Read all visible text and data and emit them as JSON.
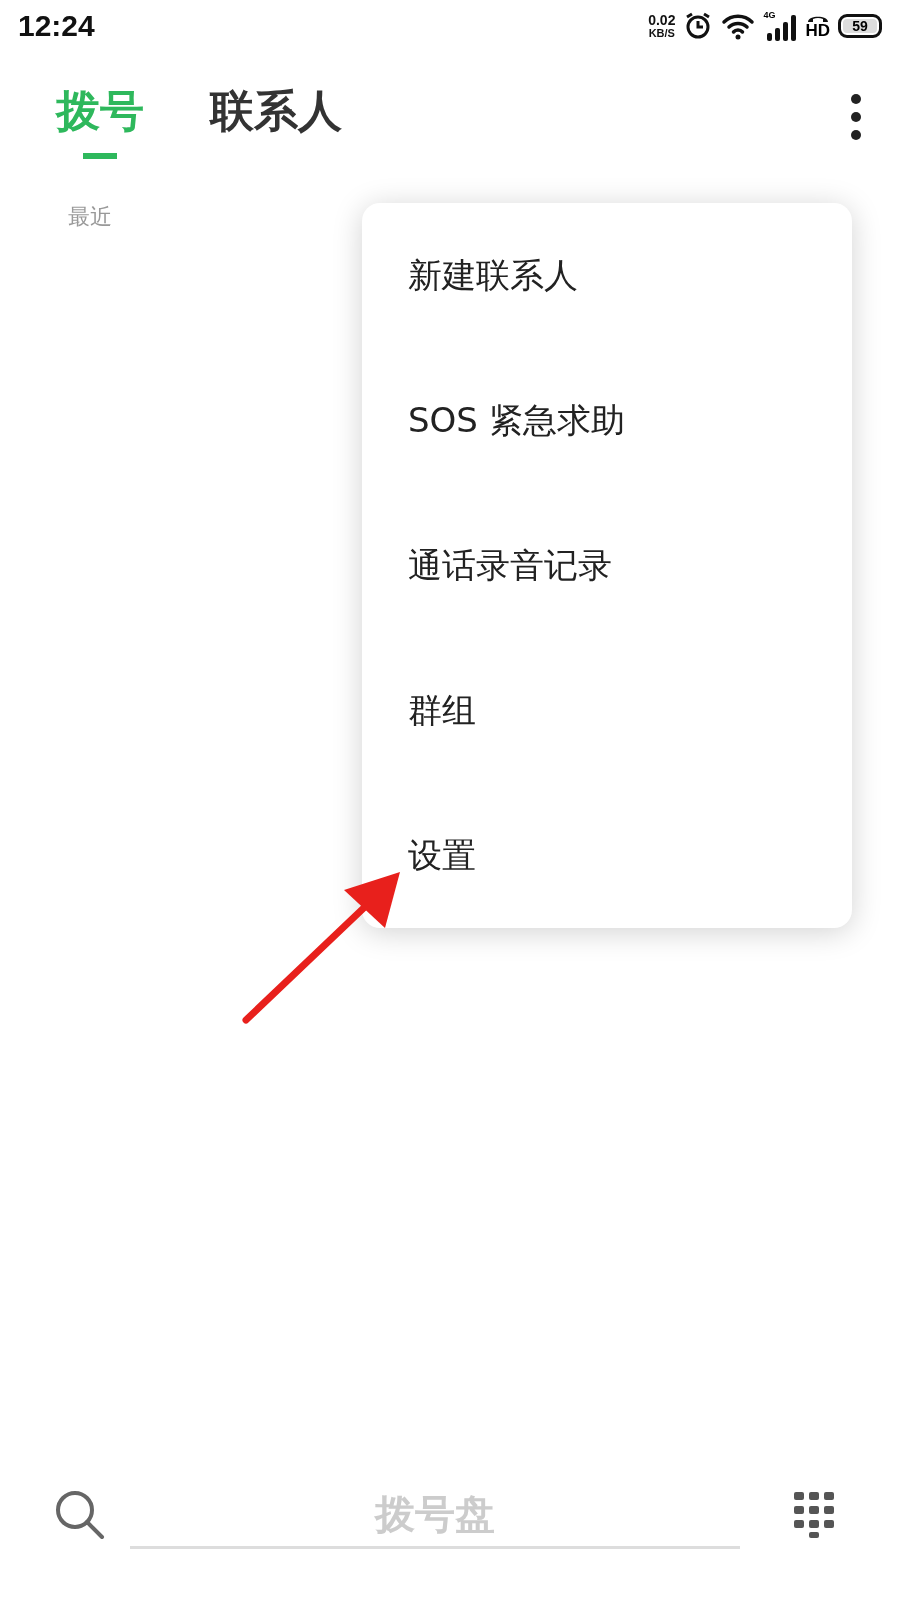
{
  "status_bar": {
    "time": "12:24",
    "net_speed": "0.02",
    "net_unit": "KB/S",
    "signal_label": "4G",
    "hd_label": "HD",
    "battery": "59"
  },
  "tabs": [
    {
      "label": "拨号",
      "selected": true
    },
    {
      "label": "联系人",
      "selected": false
    }
  ],
  "section_label": "最近",
  "menu": {
    "items": [
      {
        "label": "新建联系人"
      },
      {
        "label": "SOS 紧急求助"
      },
      {
        "label": "通话录音记录"
      },
      {
        "label": "群组"
      },
      {
        "label": "设置"
      }
    ]
  },
  "dial_field": {
    "placeholder": "拨号盘"
  }
}
